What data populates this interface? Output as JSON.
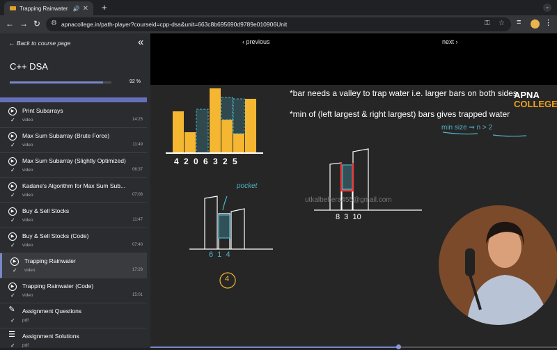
{
  "browser": {
    "tab_title": "Trapping Rainwater",
    "url": "apnacollege.in/path-player?courseid=cpp-dsa&unit=663c8b695690d9789e010906Unit"
  },
  "sidebar": {
    "back_label": "Back to course page",
    "course_title": "C++ DSA",
    "progress_percent": 92,
    "progress_label": "92 %",
    "items": [
      {
        "label": "Print Subarrays",
        "type": "video",
        "duration": "14:25",
        "icon": "play-circle-icon"
      },
      {
        "label": "Max Sum Subarray (Brute Force)",
        "type": "video",
        "duration": "11:49",
        "icon": "play-circle-icon"
      },
      {
        "label": "Max Sum Subarray (Slightly Optimized)",
        "type": "video",
        "duration": "06:37",
        "icon": "play-circle-icon"
      },
      {
        "label": "Kadane's Algorithm for Max Sum Sub...",
        "type": "video",
        "duration": "07:08",
        "icon": "play-circle-icon"
      },
      {
        "label": "Buy & Sell Stocks",
        "type": "video",
        "duration": "11:47",
        "icon": "play-circle-icon"
      },
      {
        "label": "Buy & Sell Stocks (Code)",
        "type": "video",
        "duration": "07:40",
        "icon": "play-circle-icon"
      },
      {
        "label": "Trapping Rainwater",
        "type": "video",
        "duration": "17:28",
        "icon": "play-circle-icon",
        "active": true
      },
      {
        "label": "Trapping Rainwater (Code)",
        "type": "video",
        "duration": "15:01",
        "icon": "play-circle-icon"
      },
      {
        "label": "Assignment Questions",
        "type": "pdf",
        "duration": "",
        "icon": "document-edit-icon"
      },
      {
        "label": "Assignment Solutions",
        "type": "pdf",
        "duration": "",
        "icon": "checklist-icon"
      }
    ]
  },
  "player": {
    "previous_label": "‹ previous",
    "next_label": "next ›",
    "seek_fraction": 0.61,
    "board": {
      "line1": "*bar needs a valley to trap water i.e. larger bars on both sides",
      "line2": "*min of (left largest & right largest) bars gives trapped water",
      "min_size_note": "min size ⇒ n > 2",
      "heights_label": "4 2 0 6 3 2 5",
      "pocket_label": "pocket",
      "mid_labels": "6  1  4",
      "answer": "4",
      "right_labels": "8  3  10",
      "logo_top": "APNA",
      "logo_bottom": "COLLEGE",
      "watermark": "utkalbehera455@gmail.com"
    }
  },
  "colors": {
    "accent": "#7a88c8",
    "bar": "#f5b731",
    "water": "#4fb3c9",
    "highlight": "#e53935"
  }
}
